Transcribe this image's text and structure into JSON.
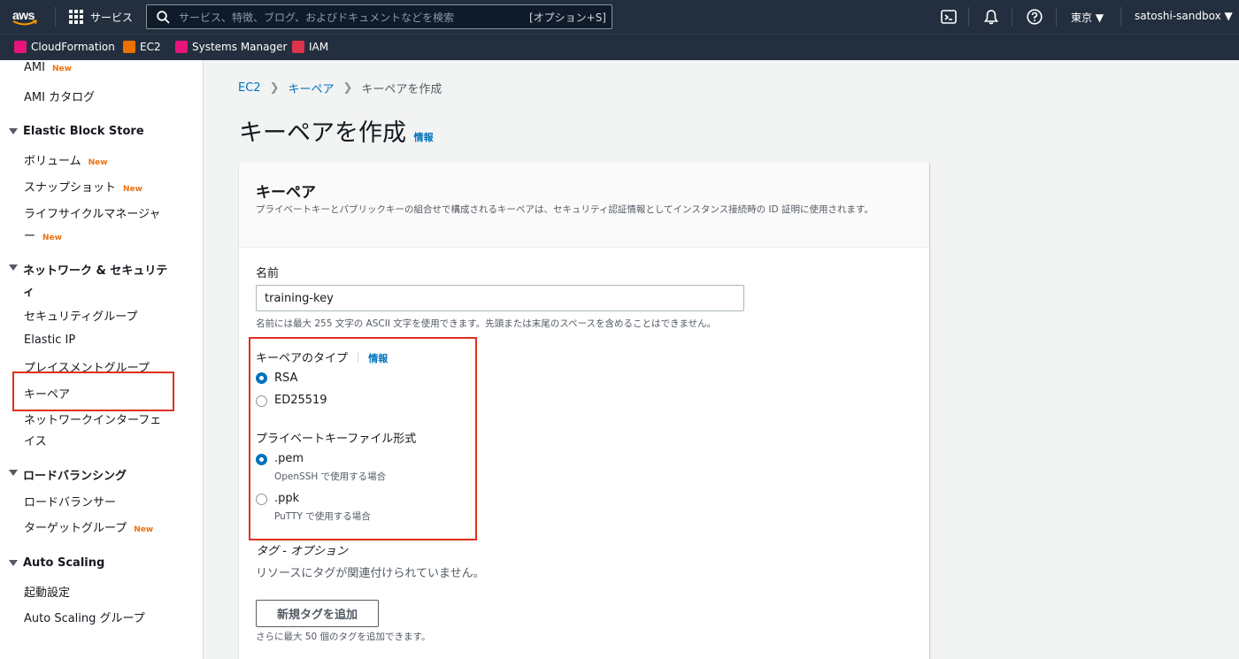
{
  "topnav": {
    "services_label": "サービス",
    "search_placeholder": "サービス、特徴、ブログ、およびドキュメントなどを検索",
    "search_shortcut": "[オプション+S]",
    "region": "東京 ▼",
    "account": "satoshi-sandbox ▼"
  },
  "favorites": [
    {
      "label": "CloudFormation",
      "color": "#e7157b"
    },
    {
      "label": "EC2",
      "color": "#ed7100"
    },
    {
      "label": "Systems Manager",
      "color": "#e7157b"
    },
    {
      "label": "IAM",
      "color": "#dd344c"
    }
  ],
  "sidebar": {
    "new_badge": "New",
    "ami": "AMI",
    "ami_catalog": "AMI カタログ",
    "ebs_head": "Elastic Block Store",
    "volumes": "ボリューム",
    "snapshots": "スナップショット",
    "lifecycle_1": "ライフサイクルマネージャ",
    "lifecycle_2": "ー",
    "netsec_head_1": "ネットワーク & セキュリテ",
    "netsec_head_2": "ィ",
    "security_groups": "セキュリティグループ",
    "elastic_ip": "Elastic IP",
    "placement_groups": "プレイスメントグループ",
    "key_pairs": "キーペア",
    "net_if_1": "ネットワークインターフェ",
    "net_if_2": "イス",
    "lb_head": "ロードバランシング",
    "load_balancers": "ロードバランサー",
    "target_groups": "ターゲットグループ",
    "as_head": "Auto Scaling",
    "launch_config": "起動設定",
    "as_groups": "Auto Scaling グループ"
  },
  "breadcrumb": [
    "EC2",
    "キーペア",
    "キーペアを作成"
  ],
  "page": {
    "title": "キーペアを作成",
    "info": "情報"
  },
  "panel": {
    "title": "キーペア",
    "desc": "プライベートキーとパブリックキーの組合せで構成されるキーペアは、セキュリティ認証情報としてインスタンス接続時の ID 証明に使用されます。",
    "name_label": "名前",
    "name_value": "training-key",
    "name_hint": "名前には最大 255 文字の ASCII 文字を使用できます。先頭または末尾のスペースを含めることはできません。",
    "type_label": "キーペアのタイプ",
    "type_info": "情報",
    "type_options": [
      {
        "label": "RSA",
        "selected": true
      },
      {
        "label": "ED25519",
        "selected": false
      }
    ],
    "format_label": "プライベートキーファイル形式",
    "format_options": [
      {
        "label": ".pem",
        "sub": "OpenSSH で使用する場合",
        "selected": true
      },
      {
        "label": ".ppk",
        "sub": "PuTTY で使用する場合",
        "selected": false
      }
    ],
    "tags_label": "タグ - オプション",
    "tags_empty": "リソースにタグが関連付けられていません。",
    "add_tag_button": "新規タグを追加",
    "tags_hint": "さらに最大 50 個のタグを追加できます。"
  },
  "colors": {
    "nav_bg": "#232f3e",
    "link": "#0073bb",
    "highlight": "#e0301e",
    "new_badge": "#ec7211"
  }
}
